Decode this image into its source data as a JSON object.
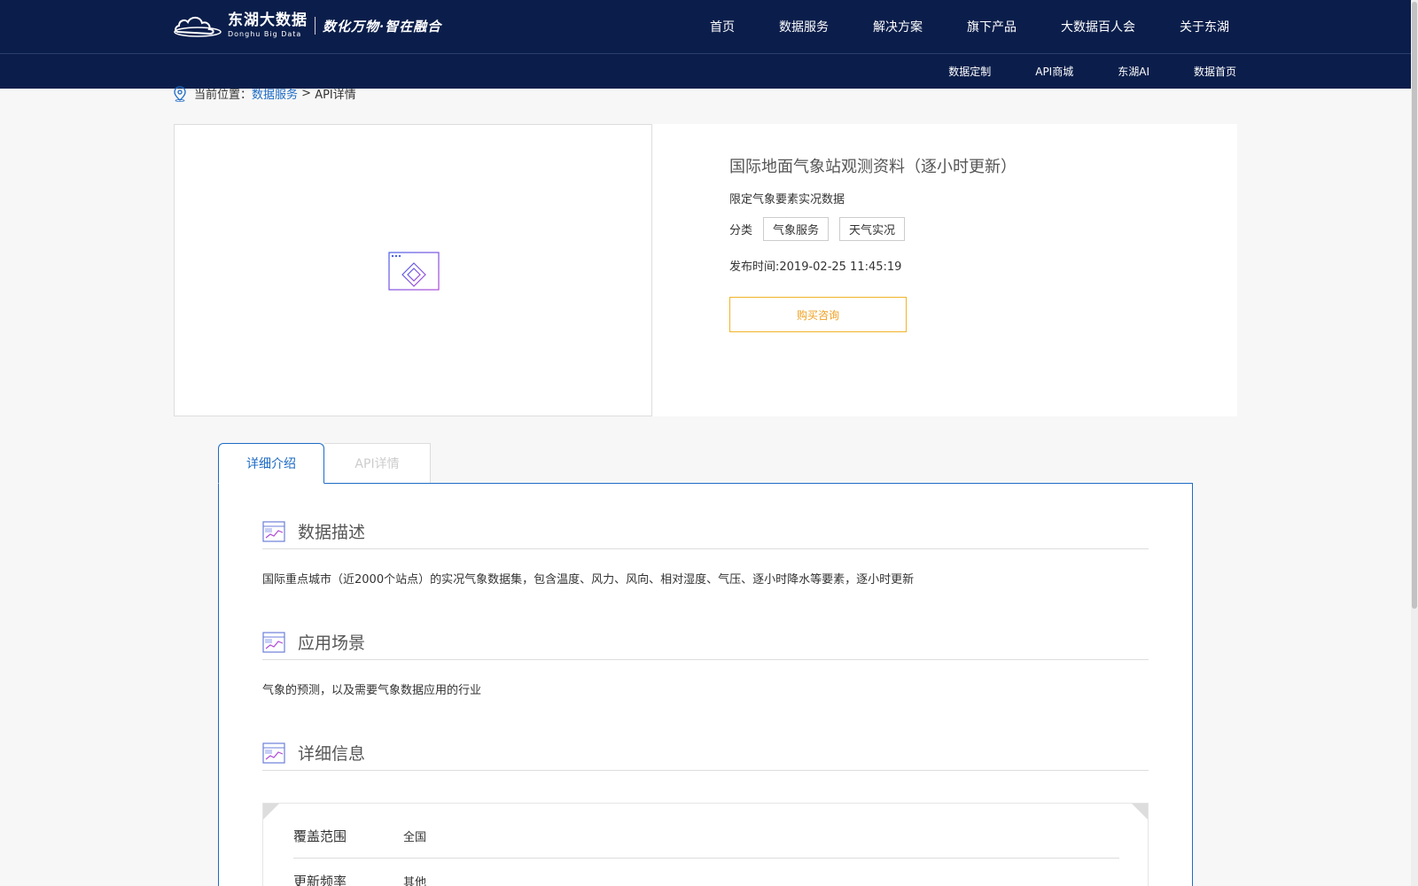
{
  "header": {
    "brand_cn": "东湖大数据",
    "brand_en": "Donghu Big Data",
    "slogan": "数化万物·智在融合",
    "main_nav": [
      "首页",
      "数据服务",
      "解决方案",
      "旗下产品",
      "大数据百人会",
      "关于东湖"
    ],
    "sub_nav": [
      "数据定制",
      "API商城",
      "东湖AI",
      "数据首页"
    ]
  },
  "breadcrumb": {
    "prefix": "当前位置：",
    "link": "数据服务",
    "separator": " > ",
    "current": "API详情"
  },
  "product": {
    "title": "国际地面气象站观测资料（逐小时更新）",
    "subtitle": "限定气象要素实况数据",
    "category_label": "分类",
    "tags": [
      "气象服务",
      "天气实况"
    ],
    "publish_time": "发布时间:2019-02-25 11:45:19",
    "buy_label": "购买咨询"
  },
  "tabs": {
    "active": "详细介绍",
    "inactive": "API详情"
  },
  "sections": {
    "description": {
      "title": "数据描述",
      "text": "国际重点城市（近2000个站点）的实况气象数据集，包含温度、风力、风向、相对湿度、气压、逐小时降水等要素，逐小时更新"
    },
    "scenario": {
      "title": "应用场景",
      "text": "气象的预测，以及需要气象数据应用的行业"
    },
    "details": {
      "title": "详细信息",
      "rows": [
        {
          "key": "覆盖范围",
          "value": "全国"
        },
        {
          "key": "更新频率",
          "value": "其他"
        }
      ]
    }
  },
  "colors": {
    "nav_bg": "#0b1e4b",
    "link_blue": "#1e6bc6",
    "buy_orange": "#f0a020"
  }
}
